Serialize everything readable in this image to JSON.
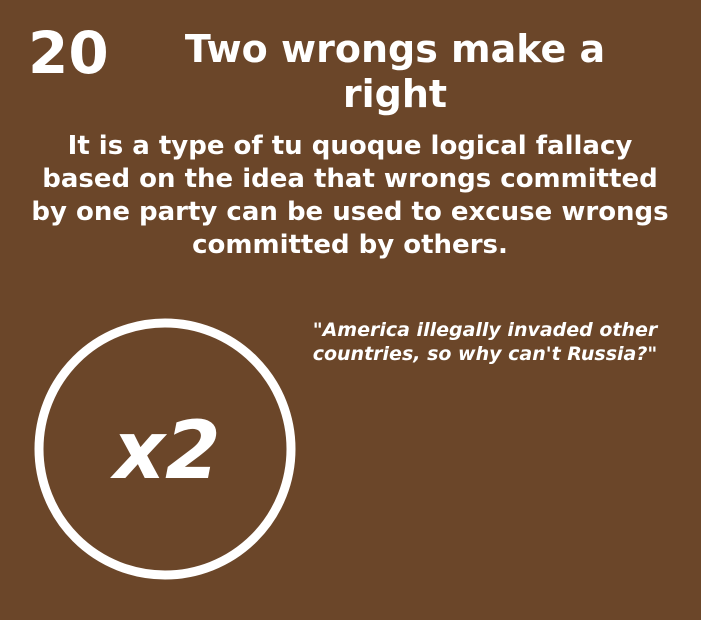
{
  "card": {
    "number": "20",
    "title": "Two wrongs make a right",
    "description": "It is a type of tu quoque logical fallacy based on the idea that wrongs committed by one party can be used to excuse wrongs committed by others.",
    "example": "\"America illegally invaded other countries, so why can't Russia?\"",
    "badge_label": "x2",
    "badge_icon": "times-two-circle-icon"
  },
  "colors": {
    "background": "#6b4629",
    "foreground": "#ffffff"
  }
}
